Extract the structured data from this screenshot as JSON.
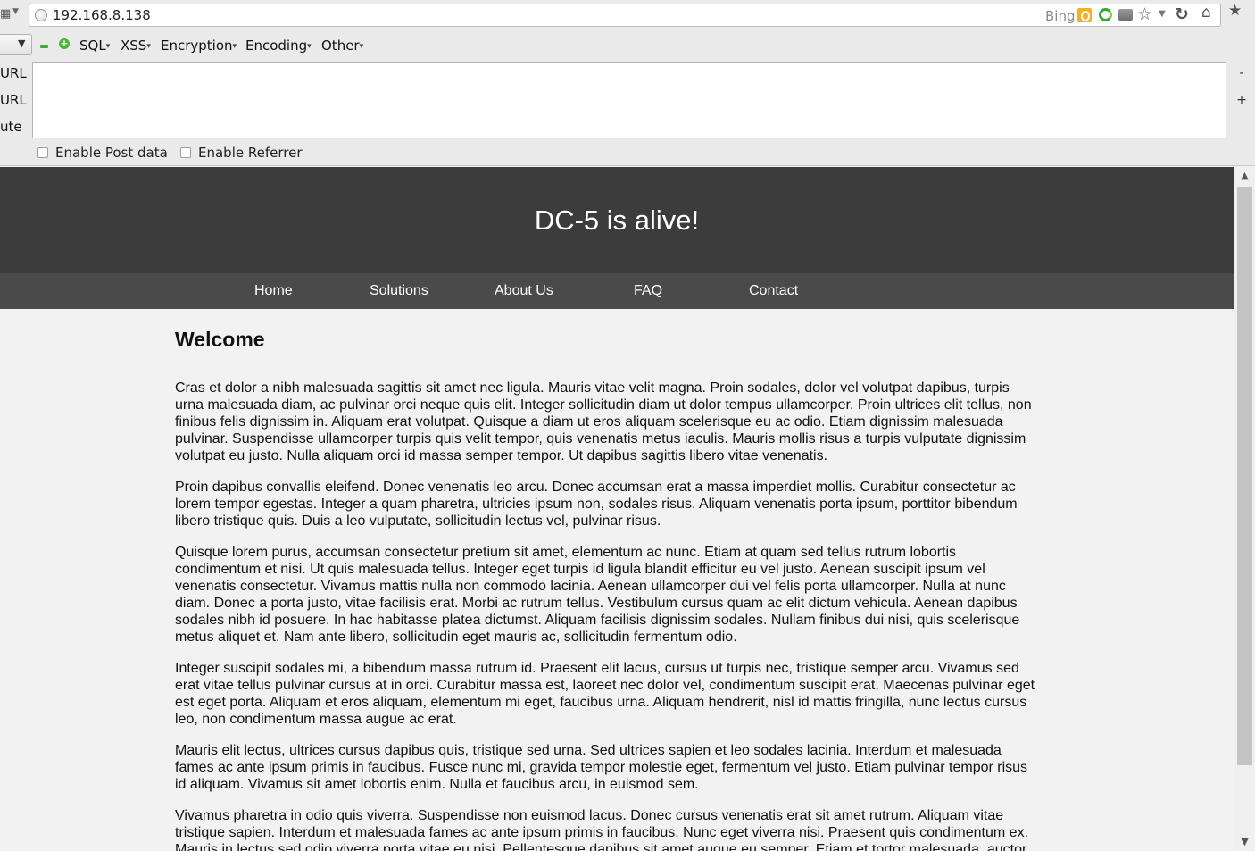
{
  "browser": {
    "url": "192.168.8.138",
    "search_engine": "Bing"
  },
  "hackbar": {
    "menus": [
      "SQL",
      "XSS",
      "Encryption",
      "Encoding",
      "Other"
    ],
    "side_labels": [
      "URL",
      "URL",
      "ute"
    ],
    "url_value": "",
    "zoom_out": "-",
    "zoom_in": "+",
    "enable_post_label": "Enable Post data",
    "enable_referrer_label": "Enable Referrer"
  },
  "site": {
    "title": "DC-5 is alive!",
    "nav": [
      "Home",
      "Solutions",
      "About Us",
      "FAQ",
      "Contact"
    ],
    "heading": "Welcome",
    "paragraphs": [
      "Cras et dolor a nibh malesuada sagittis sit amet nec ligula. Mauris vitae velit magna. Proin sodales, dolor vel volutpat dapibus, turpis urna malesuada diam, ac pulvinar orci neque quis elit. Integer sollicitudin diam ut dolor tempus ullamcorper. Proin ultrices elit tellus, non finibus felis dignissim in. Aliquam erat volutpat. Quisque a diam ut eros aliquam scelerisque eu ac odio. Etiam dignissim malesuada pulvinar. Suspendisse ullamcorper turpis quis velit tempor, quis venenatis metus iaculis. Mauris mollis risus a turpis vulputate dignissim volutpat eu justo. Nulla aliquam orci id massa semper tempor. Ut dapibus sagittis libero vitae venenatis.",
      "Proin dapibus convallis eleifend. Donec venenatis leo arcu. Donec accumsan erat a massa imperdiet mollis. Curabitur consectetur ac lorem tempor egestas. Integer a quam pharetra, ultricies ipsum non, sodales risus. Aliquam venenatis porta ipsum, porttitor bibendum libero tristique quis. Duis a leo vulputate, sollicitudin lectus vel, pulvinar risus.",
      "Quisque lorem purus, accumsan consectetur pretium sit amet, elementum ac nunc. Etiam at quam sed tellus rutrum lobortis condimentum et nisi. Ut quis malesuada tellus. Integer eget turpis id ligula blandit efficitur eu vel justo. Aenean suscipit ipsum vel venenatis consectetur. Vivamus mattis nulla non commodo lacinia. Aenean ullamcorper dui vel felis porta ullamcorper. Nulla at nunc diam. Donec a porta justo, vitae facilisis erat. Morbi ac rutrum tellus. Vestibulum cursus quam ac elit dictum vehicula. Aenean dapibus sodales nibh id posuere. In hac habitasse platea dictumst. Aliquam facilisis dignissim sodales. Nullam finibus dui nisi, quis scelerisque metus aliquet et. Nam ante libero, sollicitudin eget mauris ac, sollicitudin fermentum odio.",
      "Integer suscipit sodales mi, a bibendum massa rutrum id. Praesent elit lacus, cursus ut turpis nec, tristique semper arcu. Vivamus sed erat vitae tellus pulvinar cursus at in orci. Curabitur massa est, laoreet nec dolor vel, condimentum suscipit erat. Maecenas pulvinar eget est eget porta. Aliquam et eros aliquam, elementum mi eget, faucibus urna. Aliquam hendrerit, nisl id mattis fringilla, nunc lectus cursus leo, non condimentum massa augue ac erat.",
      "Mauris elit lectus, ultrices cursus dapibus quis, tristique sed urna. Sed ultrices sapien et leo sodales lacinia. Interdum et malesuada fames ac ante ipsum primis in faucibus. Fusce nunc mi, gravida tempor molestie eget, fermentum vel justo. Etiam pulvinar tempor risus id aliquam. Vivamus sit amet lobortis enim. Nulla et faucibus arcu, in euismod sem.",
      "Vivamus pharetra in odio quis viverra. Suspendisse non euismod lacus. Donec cursus venenatis erat sit amet rutrum. Aliquam vitae tristique sapien. Interdum et malesuada fames ac ante ipsum primis in faucibus. Nunc eget viverra nisi. Praesent quis condimentum ex. Mauris in lectus sed odio viverra porta vitae eu nisi. Pellentesque dapibus sit amet augue eu semper. Etiam et tortor malesuada, auctor nibh non, ultricies turpis. Sed a magna at nisi dictum accumsan. Aliquam erat volutpat."
    ]
  },
  "colors": {
    "header_bg": "#3c3c3c",
    "nav_bg": "#4a4a4a",
    "page_bg": "#f2f2f2"
  }
}
